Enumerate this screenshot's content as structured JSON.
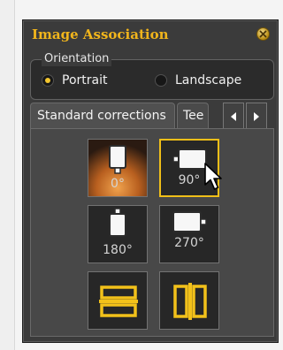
{
  "panel": {
    "title": "Image Association",
    "close_icon": "close-icon",
    "accent_color": "#f1b51c"
  },
  "orientation": {
    "label": "Orientation",
    "options": [
      {
        "label": "Portrait",
        "selected": true
      },
      {
        "label": "Landscape",
        "selected": false
      }
    ]
  },
  "tabs": {
    "items": [
      {
        "label": "Standard corrections",
        "active": true
      },
      {
        "label": "Tee",
        "active": false
      }
    ],
    "prev_icon": "chevron-left-icon",
    "next_icon": "chevron-right-icon"
  },
  "corrections": [
    {
      "name": "rotation-0",
      "label": "0°",
      "icon": "portrait-sensor-icon",
      "active": true
    },
    {
      "name": "rotation-90",
      "label": "90°",
      "icon": "landscape-sensor-icon",
      "focused": true
    },
    {
      "name": "rotation-180",
      "label": "180°",
      "icon": "portrait-sensor-icon"
    },
    {
      "name": "rotation-270",
      "label": "270°",
      "icon": "landscape-sensor-icon"
    },
    {
      "name": "flip-vertical",
      "label": "",
      "icon": "flip-vertical-icon"
    },
    {
      "name": "flip-horizontal",
      "label": "",
      "icon": "flip-horizontal-icon"
    }
  ],
  "cursor_icon": "mouse-pointer-icon"
}
